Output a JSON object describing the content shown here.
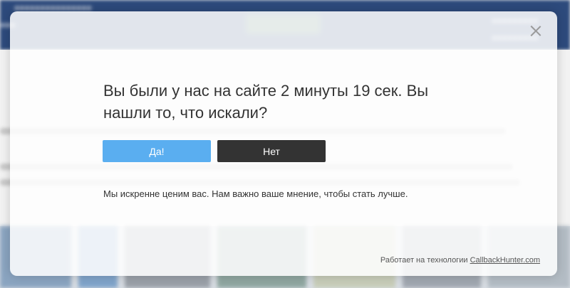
{
  "popup": {
    "question": "Вы были у нас на сайте 2 минуты 19 сек. Вы нашли то, что искали?",
    "yes_label": "Да!",
    "no_label": "Нет",
    "note": "Мы искренне ценим вас. Нам важно ваше мнение, чтобы стать лучше.",
    "powered_by": "Работает на технологии",
    "powered_link": "CallbackHunter.com",
    "close_icon": "close-icon"
  },
  "colors": {
    "yes_button": "#5aaef0",
    "no_button": "#333333",
    "header_bg": "#2d4a7c",
    "text": "#333333"
  }
}
